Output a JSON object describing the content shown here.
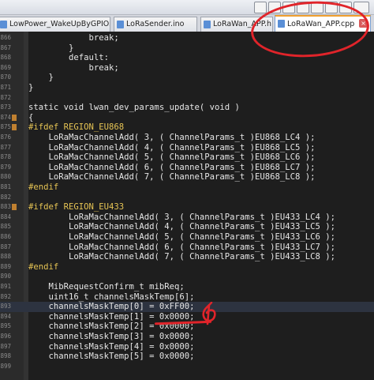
{
  "tabs": [
    {
      "label": "LowPower_WakeUpByGPIO.ino",
      "active": false
    },
    {
      "label": "LoRaSender.ino",
      "active": false
    },
    {
      "label": "LoRaWan_APP.h",
      "active": false
    },
    {
      "label": "LoRaWan_APP.cpp",
      "active": true
    }
  ],
  "lines": [
    {
      "n": "866",
      "text": "            break;"
    },
    {
      "n": "867",
      "text": "        }"
    },
    {
      "n": "868",
      "text": "        default:"
    },
    {
      "n": "869",
      "text": "            break;"
    },
    {
      "n": "870",
      "text": "    }"
    },
    {
      "n": "871",
      "text": "}"
    },
    {
      "n": "872",
      "text": ""
    },
    {
      "n": "873",
      "text": "static void lwan_dev_params_update( void )"
    },
    {
      "n": "874",
      "text": "{"
    },
    {
      "n": "875",
      "text": "#ifdef REGION_EU868",
      "pp": true
    },
    {
      "n": "876",
      "text": "    LoRaMacChannelAdd( 3, ( ChannelParams_t )EU868_LC4 );"
    },
    {
      "n": "877",
      "text": "    LoRaMacChannelAdd( 4, ( ChannelParams_t )EU868_LC5 );"
    },
    {
      "n": "878",
      "text": "    LoRaMacChannelAdd( 5, ( ChannelParams_t )EU868_LC6 );"
    },
    {
      "n": "879",
      "text": "    LoRaMacChannelAdd( 6, ( ChannelParams_t )EU868_LC7 );"
    },
    {
      "n": "880",
      "text": "    LoRaMacChannelAdd( 7, ( ChannelParams_t )EU868_LC8 );"
    },
    {
      "n": "881",
      "text": "#endif",
      "pp": true
    },
    {
      "n": "882",
      "text": ""
    },
    {
      "n": "883",
      "text": "#ifdef REGION_EU433",
      "pp": true
    },
    {
      "n": "884",
      "text": "        LoRaMacChannelAdd( 3, ( ChannelParams_t )EU433_LC4 );"
    },
    {
      "n": "885",
      "text": "        LoRaMacChannelAdd( 4, ( ChannelParams_t )EU433_LC5 );"
    },
    {
      "n": "886",
      "text": "        LoRaMacChannelAdd( 5, ( ChannelParams_t )EU433_LC6 );"
    },
    {
      "n": "887",
      "text": "        LoRaMacChannelAdd( 6, ( ChannelParams_t )EU433_LC7 );"
    },
    {
      "n": "888",
      "text": "        LoRaMacChannelAdd( 7, ( ChannelParams_t )EU433_LC8 );"
    },
    {
      "n": "889",
      "text": "#endif",
      "pp": true
    },
    {
      "n": "890",
      "text": ""
    },
    {
      "n": "891",
      "text": "    MibRequestConfirm_t mibReq;"
    },
    {
      "n": "892",
      "text": "    uint16_t channelsMaskTemp[6];"
    },
    {
      "n": "893",
      "text": "    channelsMaskTemp[0] = 0xFF00;",
      "hl": true
    },
    {
      "n": "894",
      "text": "    channelsMaskTemp[1] = 0x0000;"
    },
    {
      "n": "895",
      "text": "    channelsMaskTemp[2] = 0x0000;"
    },
    {
      "n": "896",
      "text": "    channelsMaskTemp[3] = 0x0000;"
    },
    {
      "n": "897",
      "text": "    channelsMaskTemp[4] = 0x0000;"
    },
    {
      "n": "898",
      "text": "    channelsMaskTemp[5] = 0x0000;"
    },
    {
      "n": "899",
      "text": ""
    }
  ]
}
